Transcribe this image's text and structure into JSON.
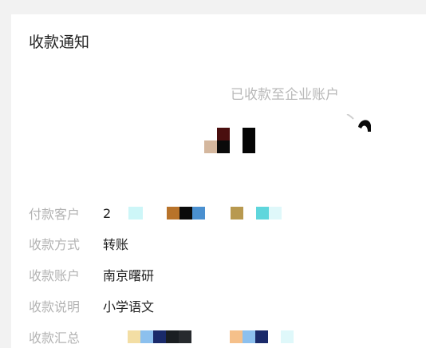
{
  "notice": {
    "title": "收款通知",
    "status": "已收款至企业账户"
  },
  "fields": [
    {
      "label": "付款客户",
      "value": "2",
      "obscured": true
    },
    {
      "label": "收款方式",
      "value": "转账"
    },
    {
      "label": "收款账户",
      "value": "南京曙研"
    },
    {
      "label": "收款说明",
      "value": "小学语文"
    },
    {
      "label": "收款汇总",
      "value": "",
      "obscured": true
    }
  ]
}
